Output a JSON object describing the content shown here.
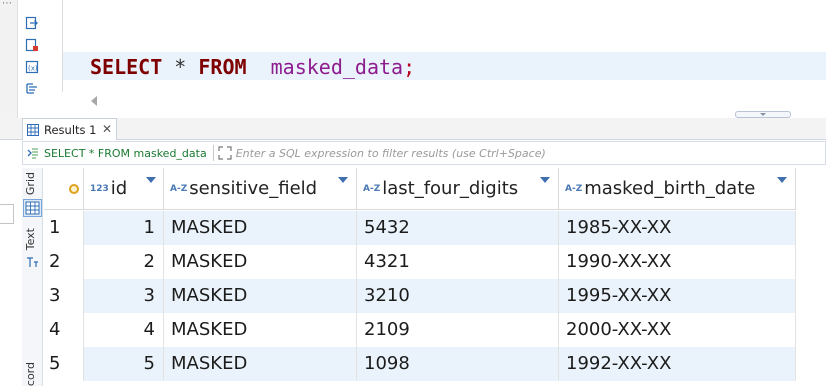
{
  "editor": {
    "sql_select": "SELECT",
    "sql_star": " * ",
    "sql_from": "FROM",
    "sql_gap": "  ",
    "sql_table": "masked_data",
    "sql_semicolon": ";"
  },
  "results_tab": {
    "label": "Results 1",
    "close_glyph": "✕"
  },
  "filter": {
    "query_label": "SELECT * FROM masked_data",
    "placeholder": "Enter a SQL expression to filter results (use Ctrl+Space)"
  },
  "side_tabs": {
    "grid": "Grid",
    "text": "Text",
    "record": "ecord"
  },
  "columns": [
    {
      "type": "123",
      "label": "id"
    },
    {
      "type": "A-Z",
      "label": "sensitive_field"
    },
    {
      "type": "A-Z",
      "label": "last_four_digits"
    },
    {
      "type": "A-Z",
      "label": "masked_birth_date"
    }
  ],
  "rows": [
    {
      "num": "1",
      "id": "1",
      "sensitive_field": "MASKED",
      "last_four_digits": "5432",
      "masked_birth_date": "1985-XX-XX"
    },
    {
      "num": "2",
      "id": "2",
      "sensitive_field": "MASKED",
      "last_four_digits": "4321",
      "masked_birth_date": "1990-XX-XX"
    },
    {
      "num": "3",
      "id": "3",
      "sensitive_field": "MASKED",
      "last_four_digits": "3210",
      "masked_birth_date": "1995-XX-XX"
    },
    {
      "num": "4",
      "id": "4",
      "sensitive_field": "MASKED",
      "last_four_digits": "2109",
      "masked_birth_date": "2000-XX-XX"
    },
    {
      "num": "5",
      "id": "5",
      "sensitive_field": "MASKED",
      "last_four_digits": "1098",
      "masked_birth_date": "1992-XX-XX"
    }
  ],
  "colors": {
    "keyword": "#7f0000",
    "table_name": "#8e1c8e",
    "current_line": "#eaf2fb",
    "alt_row": "#eaf3fb",
    "query_green": "#1a7a30"
  }
}
